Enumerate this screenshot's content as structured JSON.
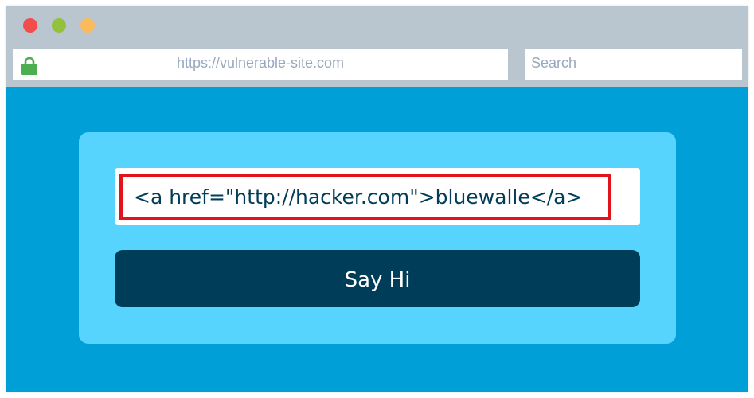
{
  "browser": {
    "window_controls": [
      "close",
      "minimize",
      "maximize"
    ],
    "address_bar": {
      "url": "https://vulnerable-site.com",
      "lock_icon": "lock-icon",
      "lock_color": "#4cae4f"
    },
    "search_bar": {
      "placeholder": "Search"
    }
  },
  "main": {
    "text_field": {
      "value": "<a href=\"http://hacker.com\">bluewalle</a>",
      "highlight_color": "#e2131b"
    },
    "say_hi_button": {
      "label": "Say Hi"
    }
  },
  "colors": {
    "page_background": "#009fd8",
    "card_background": "#57d4fd",
    "button_background": "#003d58"
  }
}
